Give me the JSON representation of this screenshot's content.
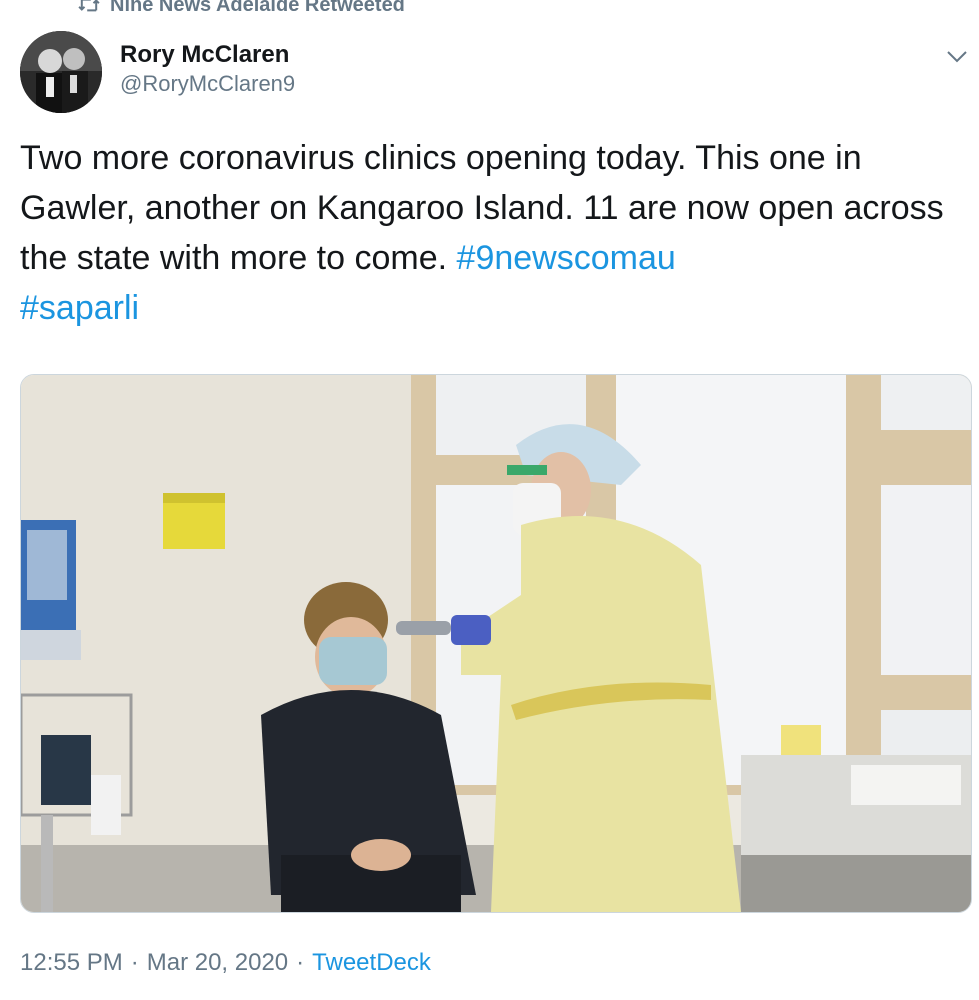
{
  "retweet": {
    "label": "Nine News Adelaide Retweeted",
    "icon": "retweet-icon"
  },
  "author": {
    "display_name": "Rory McClaren",
    "handle": "@RoryMcClaren9",
    "avatar_icon": "avatar-photo"
  },
  "menu": {
    "icon": "chevron-down-icon"
  },
  "tweet": {
    "text": "Two more coronavirus clinics opening today. This one in Gawler, another on Kangaroo Island. 11 are now open across the state with more to come. ",
    "hashtags": [
      "#9newscomau",
      "#saparli"
    ]
  },
  "meta": {
    "time": "12:55 PM",
    "date": "Mar 20, 2020",
    "separator": "·",
    "source": "TweetDeck"
  },
  "colors": {
    "link": "#1b95e0",
    "secondary": "#657786",
    "text": "#14171a"
  }
}
